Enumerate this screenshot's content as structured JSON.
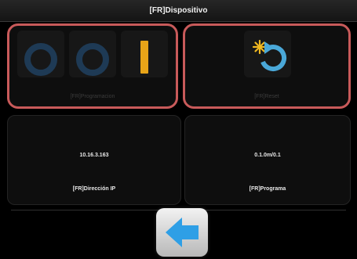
{
  "header": {
    "title": "[FR]Dispositivo"
  },
  "tiles": {
    "programacion": {
      "label": "[FR]Programacion",
      "icons": [
        "ring-icon",
        "ring-icon",
        "bar-icon"
      ]
    },
    "reset": {
      "label": "[FR]Reset",
      "icon": "reset-icon"
    },
    "ip": {
      "value": "10.16.3.163",
      "label": "[FR]Dirección IP"
    },
    "programa": {
      "value": "0.1.0m/0.1",
      "label": "[FR]Programa"
    }
  },
  "footer": {
    "back_icon": "left-arrow-icon"
  },
  "colors": {
    "highlight_border": "#c85a5a",
    "ring": "#1e3a55",
    "bar": "#e8a418",
    "reset_arrow": "#4aa8d8",
    "reset_sun": "#f0b820",
    "back_arrow": "#2e9fe6"
  }
}
